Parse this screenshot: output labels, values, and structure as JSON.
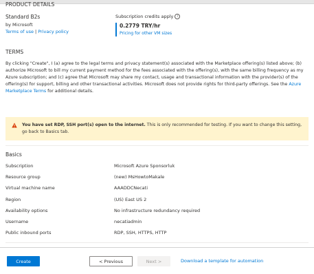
{
  "product_details": {
    "header": "PRODUCT DETAILS",
    "name": "Standard B2s",
    "by": "by Microsoft",
    "terms_of_use": "Terms of use",
    "separator": "|",
    "privacy_policy": "Privacy policy",
    "credits_label": "Subscription credits apply",
    "price": "0.2779 TRY/hr",
    "pricing_link": "Pricing for other VM sizes"
  },
  "terms": {
    "header": "TERMS",
    "body_part1": "By clicking \"Create\", I (a) agree to the legal terms and privacy statement(s) associated with the Marketplace offering(s) listed above; (b) authorize Microsoft to bill my current payment method for the fees associated with the offering(s), with the same billing frequency as my Azure subscription; and (c) agree that Microsoft may share my contact, usage and transactional information with the provider(s) of the offering(s) for support, billing and other transactional activities. Microsoft does not provide rights for third-party offerings. See the ",
    "link": "Azure Marketplace Terms",
    "body_part2": " for additional details."
  },
  "warning": {
    "bold_text": "You have set RDP, SSH port(s) open to the internet.",
    "text": "  This is only recommended for testing.  If you want to change this setting, go back to Basics tab.",
    "color": "#fff4ce",
    "icon_color": "#d83b01"
  },
  "basics": {
    "header": "Basics",
    "rows": [
      {
        "label": "Subscription",
        "value": "Microsoft Azure Sponsorluk"
      },
      {
        "label": "Resource group",
        "value": "(new) MsHowtoMakale"
      },
      {
        "label": "Virtual machine name",
        "value": "AAADDCNecati"
      },
      {
        "label": "Region",
        "value": "(US) East US 2"
      },
      {
        "label": "Availability options",
        "value": "No infrastructure redundancy required"
      },
      {
        "label": "Username",
        "value": "necatiadmin"
      },
      {
        "label": "Public inbound ports",
        "value": "RDP, SSH, HTTPS, HTTP"
      }
    ]
  },
  "footer": {
    "create": "Create",
    "previous": "< Previous",
    "next": "Next >",
    "download": "Download a template for automation"
  },
  "colors": {
    "accent": "#0078d4",
    "text": "#323130"
  }
}
